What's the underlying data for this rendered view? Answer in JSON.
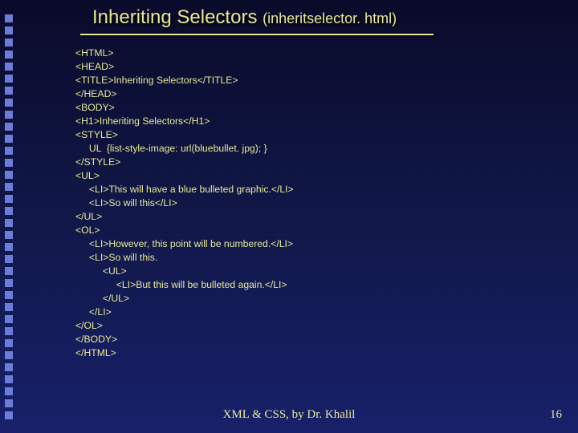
{
  "title": {
    "main": "Inheriting Selectors ",
    "paren": "(inheritselector. html)"
  },
  "code": "<HTML>\n<HEAD>\n<TITLE>Inheriting Selectors</TITLE>\n</HEAD>\n<BODY>\n<H1>Inheriting Selectors</H1>\n<STYLE>\n     UL  {list-style-image: url(bluebullet. jpg); }\n</STYLE>\n<UL>\n     <LI>This will have a blue bulleted graphic.</LI>\n     <LI>So will this</LI>\n</UL>\n<OL>\n     <LI>However, this point will be numbered.</LI>\n     <LI>So will this.\n          <UL>\n               <LI>But this will be bulleted again.</LI>\n          </UL>\n     </LI>\n</OL>\n</BODY>\n</HTML>",
  "footer": "XML & CSS, by Dr. Khalil",
  "page_number": "16"
}
